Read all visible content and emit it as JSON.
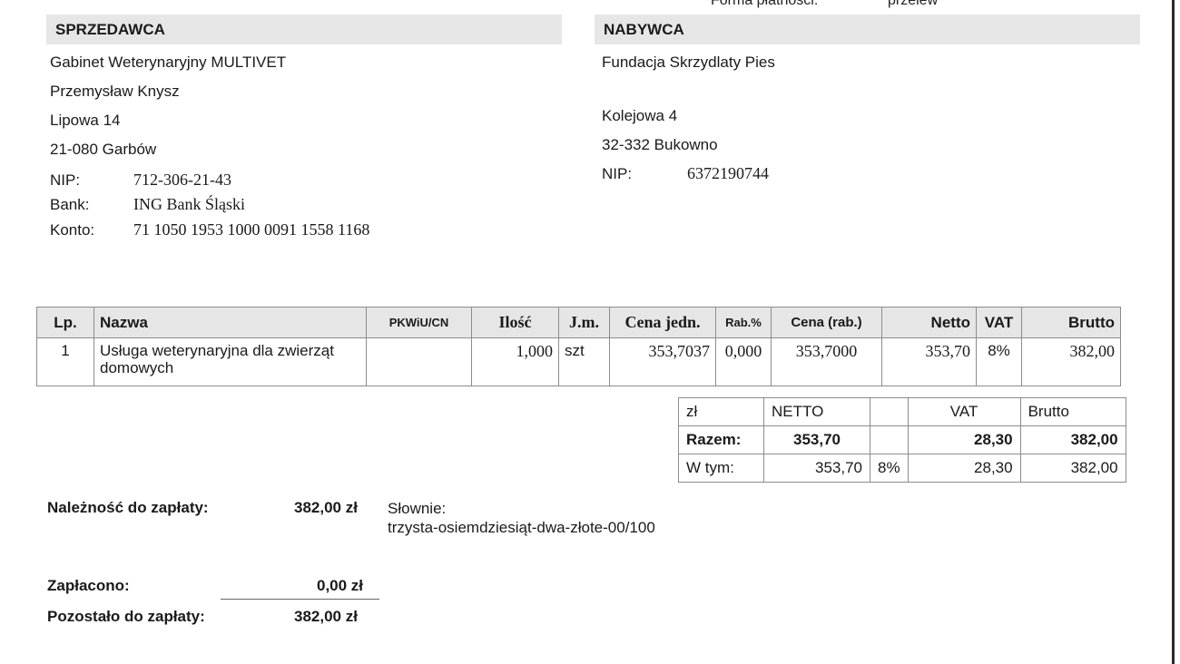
{
  "top": {
    "payment_label": "Forma płatności:",
    "payment_value": "przelew"
  },
  "seller": {
    "heading": "SPRZEDAWCA",
    "name": "Gabinet Weterynaryjny MULTIVET",
    "person": "Przemysław Knysz",
    "street": "Lipowa 14",
    "city": "21-080 Garbów",
    "nip_label": "NIP:",
    "nip": "712-306-21-43",
    "bank_label": "Bank:",
    "bank": "ING Bank Śląski",
    "account_label": "Konto:",
    "account": "71 1050 1953 1000 0091 1558 1168"
  },
  "buyer": {
    "heading": "NABYWCA",
    "name": "Fundacja Skrzydlaty Pies",
    "street": "Kolejowa 4",
    "city": "32-332 Bukowno",
    "nip_label": "NIP:",
    "nip": "6372190744"
  },
  "items": {
    "headers": [
      "Lp.",
      "Nazwa",
      "PKWiU/CN",
      "Ilość",
      "J.m.",
      "Cena jedn.",
      "Rab.%",
      "Cena (rab.)",
      "Netto",
      "VAT",
      "Brutto"
    ],
    "rows": [
      [
        "1",
        "Usługa weterynaryjna dla zwierząt domowych",
        "",
        "1,000",
        "szt",
        "353,7037",
        "0,000",
        "353,7000",
        "353,70",
        "8%",
        "382,00"
      ]
    ]
  },
  "summary": {
    "header": [
      "zł",
      "NETTO",
      "",
      "VAT",
      "Brutto"
    ],
    "total": [
      "Razem:",
      "353,70",
      "",
      "28,30",
      "382,00"
    ],
    "breakdown": [
      "W tym:",
      "353,70",
      "8%",
      "28,30",
      "382,00"
    ]
  },
  "payment": {
    "due_label": "Należność do zapłaty:",
    "due_value": "382,00 zł",
    "words_label": "Słownie:",
    "words_value": "trzysta-osiemdziesiąt-dwa-złote-00/100",
    "paid_label": "Zapłacono:",
    "paid_value": "0,00 zł",
    "remaining_label": "Pozostało do zapłaty:",
    "remaining_value": "382,00 zł"
  }
}
